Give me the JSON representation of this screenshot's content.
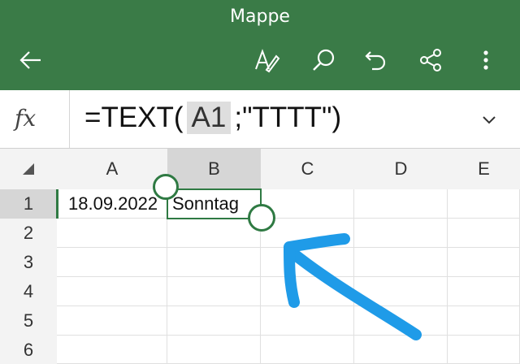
{
  "app": {
    "title": "Mappe"
  },
  "toolbar": {
    "back_icon": "arrow-left-icon",
    "draw_icon": "pen-draw-icon",
    "search_icon": "search-icon",
    "undo_icon": "undo-icon",
    "share_icon": "share-icon",
    "more_icon": "more-vertical-icon"
  },
  "formula_bar": {
    "fx_label": "fx",
    "prefix": "=TEXT(",
    "ref": "A1",
    "suffix": ";\"TTTT\")",
    "expand_icon": "chevron-down-icon"
  },
  "sheet": {
    "columns": [
      "A",
      "B",
      "C",
      "D",
      "E"
    ],
    "rows": [
      "1",
      "2",
      "3",
      "4",
      "5",
      "6"
    ],
    "selected_column": "B",
    "selected_row": "1",
    "cells": {
      "A1": "18.09.2022",
      "B1": "Sonntag"
    }
  },
  "colors": {
    "header_bar": "#3a7b47",
    "selection": "#2f7a43",
    "annotation": "#1f9be8",
    "ref_highlight": "#dedede"
  }
}
